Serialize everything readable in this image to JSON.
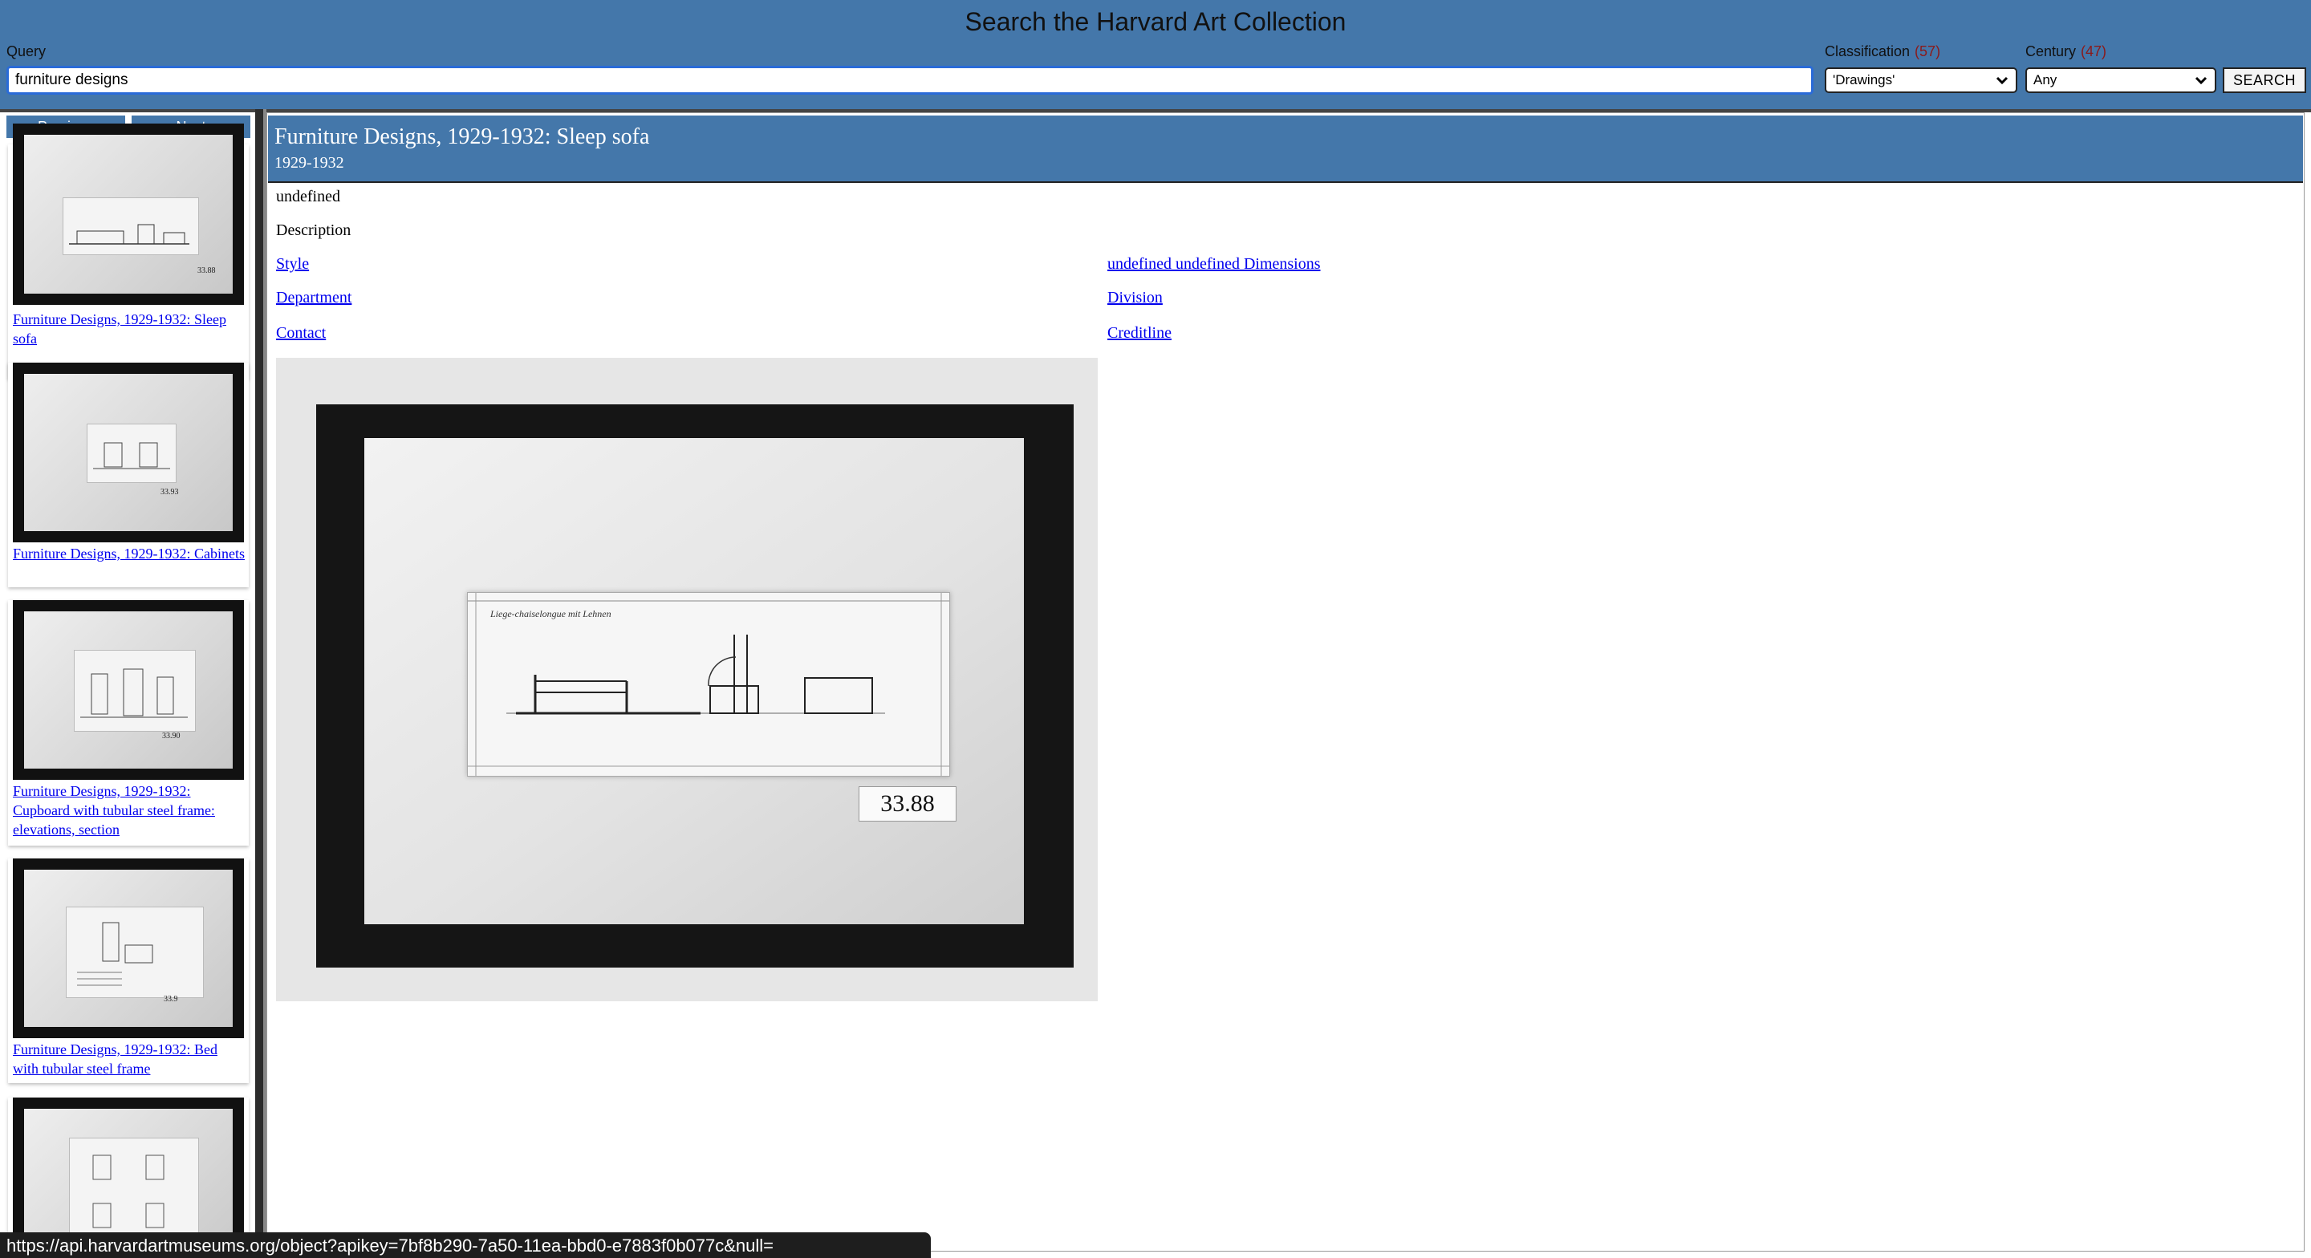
{
  "header": {
    "title": "Search the Harvard Art Collection",
    "query_label": "Query",
    "query_value": "furniture designs",
    "classification_label": "Classification",
    "classification_count": "(57)",
    "classification_value": "'Drawings'",
    "century_label": "Century",
    "century_count": "(47)",
    "century_value": "Any",
    "search_label": "SEARCH"
  },
  "sidebar": {
    "previous_label": "Previous",
    "next_label": "Next",
    "results": [
      {
        "title": "Furniture Designs, 1929-1932: Sleep sofa",
        "number": "33.88"
      },
      {
        "title": "Furniture Designs, 1929-1932: Cabinets",
        "number": "33.93"
      },
      {
        "title": "Furniture Designs, 1929-1932: Cupboard with tubular steel frame: elevations, section",
        "number": "33.90"
      },
      {
        "title": "Furniture Designs, 1929-1932: Bed with tubular steel frame",
        "number": "33.9"
      },
      {
        "title": "",
        "number": ""
      }
    ]
  },
  "object": {
    "title": "Furniture Designs, 1929-1932: Sleep sofa",
    "dated": "1929-1932",
    "culture": "undefined",
    "description": "Description",
    "style_link": "Style",
    "dimensions_link": "undefined undefined Dimensions",
    "department_link": "Department",
    "division_link": "Division",
    "contact_link": "Contact",
    "creditline_link": "Creditline",
    "image_number": "33.88",
    "image_inscription": "Liege-chaiselongue mit Lehnen"
  },
  "status_bar": {
    "url": "https://api.harvardartmuseums.org/object?apikey=7bf8b290-7a50-11ea-bbd0-e7883f0b077c&null="
  }
}
